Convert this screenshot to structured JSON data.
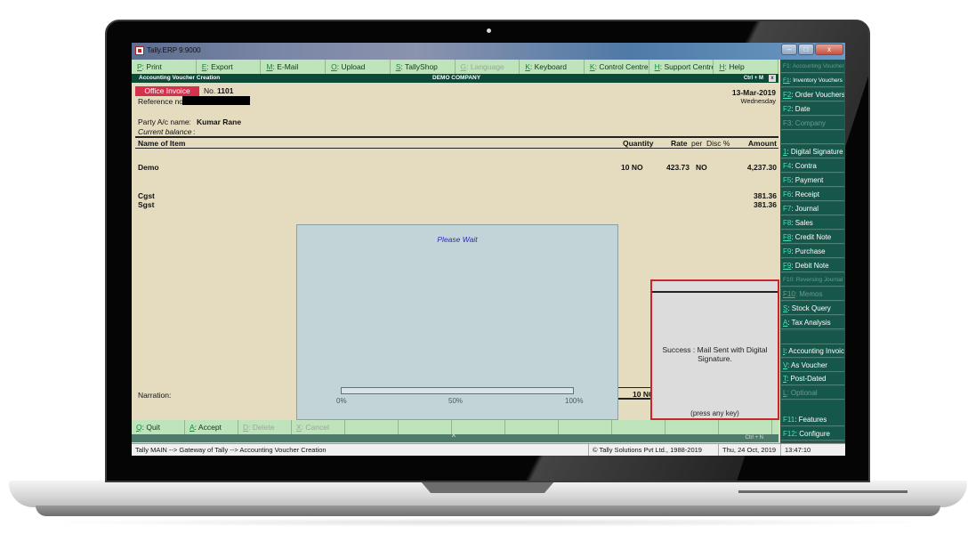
{
  "window": {
    "title": "Tally.ERP 9:9000",
    "controls": [
      "minimize",
      "maximize",
      "close"
    ]
  },
  "top_menu": [
    {
      "key": "P",
      "label": ": Print",
      "enabled": true
    },
    {
      "key": "E",
      "label": ": Export",
      "enabled": true
    },
    {
      "key": "M",
      "label": ": E-Mail",
      "enabled": true
    },
    {
      "key": "O",
      "label": ": Upload",
      "enabled": true
    },
    {
      "key": "S",
      "label": ": TallyShop",
      "enabled": true
    },
    {
      "key": "G",
      "label": ": Language",
      "enabled": false
    },
    {
      "key": "K",
      "label": ": Keyboard",
      "enabled": true
    },
    {
      "key": "K",
      "label": ": Control Centre",
      "enabled": true
    },
    {
      "key": "H",
      "label": ": Support Centre",
      "enabled": true
    },
    {
      "key": "H",
      "label": ": Help",
      "enabled": true
    }
  ],
  "header": {
    "screen_title": "Accounting Voucher  Creation",
    "company": "DEMO COMPANY",
    "shortcut": "Ctrl + M",
    "close_label": "x"
  },
  "voucher": {
    "type": "Office Invoice",
    "no_label": "No.",
    "number": "1101",
    "reference_label": "Reference no.:",
    "reference_value": "",
    "date": "13-Mar-2019",
    "day": "Wednesday",
    "party_label": "Party A/c name",
    "party_sep": ":",
    "party_name": "Kumar Rane",
    "balance_label": "Current balance",
    "balance_sep": ":"
  },
  "table": {
    "columns": {
      "name": "Name of Item",
      "quantity": "Quantity",
      "rate": "Rate",
      "per": "per",
      "disc": "Disc %",
      "amount": "Amount"
    },
    "rows": [
      {
        "name": "Demo",
        "quantity": "10 NO",
        "rate": "423.73",
        "per": "NO",
        "amount": "4,237.30"
      },
      {
        "name": "Cgst",
        "quantity": "",
        "rate": "",
        "per": "",
        "amount": "381.36"
      },
      {
        "name": "Sgst",
        "quantity": "",
        "rate": "",
        "per": "",
        "amount": "381.36"
      }
    ],
    "narration_label": "Narration:",
    "total_quantity": "10 NO"
  },
  "wait_dialog": {
    "message": "Please Wait",
    "progress_percent": 0,
    "tick_labels": [
      "0%",
      "50%",
      "100%"
    ]
  },
  "success_dialog": {
    "message": "Success : Mail Sent with Digital Signature.",
    "hint": "(press any key)"
  },
  "bottom_menu": [
    {
      "key": "Q",
      "label": ": Quit",
      "enabled": true
    },
    {
      "key": "A",
      "label": ": Accept",
      "enabled": true
    },
    {
      "key": "D",
      "label": ": Delete",
      "enabled": false
    },
    {
      "key": "X",
      "label": ": Cancel",
      "enabled": false
    },
    {
      "key": "",
      "label": "",
      "enabled": false
    },
    {
      "key": "",
      "label": "",
      "enabled": false
    },
    {
      "key": "",
      "label": "",
      "enabled": false
    },
    {
      "key": "",
      "label": "",
      "enabled": false
    },
    {
      "key": "",
      "label": "",
      "enabled": false
    },
    {
      "key": "",
      "label": "",
      "enabled": false
    },
    {
      "key": "",
      "label": "",
      "enabled": false
    },
    {
      "key": "",
      "label": "",
      "enabled": false
    }
  ],
  "bottom_bar": {
    "caret": "^",
    "shortcut": "Ctrl + N"
  },
  "right_panel": [
    {
      "key": "F1",
      "label": ": Accounting Vouchers",
      "enabled": false,
      "underline": false,
      "small": true
    },
    {
      "key": "F1",
      "label": ": Inventory Vouchers",
      "enabled": true,
      "underline": true,
      "small": true
    },
    {
      "key": "F2",
      "label": ": Order Vouchers",
      "enabled": true,
      "underline": true,
      "small": false
    },
    {
      "key": "F2",
      "label": ": Date",
      "enabled": true,
      "underline": false,
      "small": false
    },
    {
      "key": "F3",
      "label": ": Company",
      "enabled": false,
      "underline": false,
      "small": false
    },
    {
      "key": "",
      "label": "",
      "enabled": false,
      "underline": false,
      "small": false
    },
    {
      "key": "1",
      "label": ": Digital Signature",
      "enabled": true,
      "underline": true,
      "small": false
    },
    {
      "key": "F4",
      "label": ": Contra",
      "enabled": true,
      "underline": false,
      "small": false
    },
    {
      "key": "F5",
      "label": ": Payment",
      "enabled": true,
      "underline": false,
      "small": false
    },
    {
      "key": "F6",
      "label": ": Receipt",
      "enabled": true,
      "underline": false,
      "small": false
    },
    {
      "key": "F7",
      "label": ": Journal",
      "enabled": true,
      "underline": false,
      "small": false
    },
    {
      "key": "F8",
      "label": ": Sales",
      "enabled": true,
      "underline": false,
      "small": false
    },
    {
      "key": "F8",
      "label": ": Credit Note",
      "enabled": true,
      "underline": true,
      "small": false
    },
    {
      "key": "F9",
      "label": ": Purchase",
      "enabled": true,
      "underline": false,
      "small": false
    },
    {
      "key": "F9",
      "label": ": Debit Note",
      "enabled": true,
      "underline": true,
      "small": false
    },
    {
      "key": "F10",
      "label": ": Reversing Journal",
      "enabled": false,
      "underline": false,
      "small": true
    },
    {
      "key": "F10",
      "label": ": Memos",
      "enabled": false,
      "underline": true,
      "small": false
    },
    {
      "key": "S",
      "label": ": Stock Query",
      "enabled": true,
      "underline": true,
      "small": false
    },
    {
      "key": "A",
      "label": ": Tax Analysis",
      "enabled": true,
      "underline": true,
      "small": false
    },
    {
      "key": "",
      "label": "",
      "enabled": false,
      "underline": false,
      "small": false
    },
    {
      "key": "I",
      "label": ": Accounting Invoice",
      "enabled": true,
      "underline": true,
      "small": false
    },
    {
      "key": "V",
      "label": ": As Voucher",
      "enabled": true,
      "underline": true,
      "small": false
    },
    {
      "key": "T",
      "label": ": Post-Dated",
      "enabled": true,
      "underline": true,
      "small": false
    },
    {
      "key": "L",
      "label": ": Optional",
      "enabled": false,
      "underline": true,
      "small": false
    },
    {
      "key": "",
      "label": "",
      "enabled": false,
      "underline": false,
      "small": false
    },
    {
      "key": "F11",
      "label": ": Features",
      "enabled": true,
      "underline": false,
      "small": false
    },
    {
      "key": "F12",
      "label": ": Configure",
      "enabled": true,
      "underline": false,
      "small": false
    }
  ],
  "status_bar": {
    "path": "Tally MAIN --> Gateway of Tally --> Accounting Voucher  Creation",
    "copyright": "© Tally Solutions Pvt Ltd., 1988-2019",
    "date": "Thu, 24 Oct, 2019",
    "time": "13:47:10"
  }
}
